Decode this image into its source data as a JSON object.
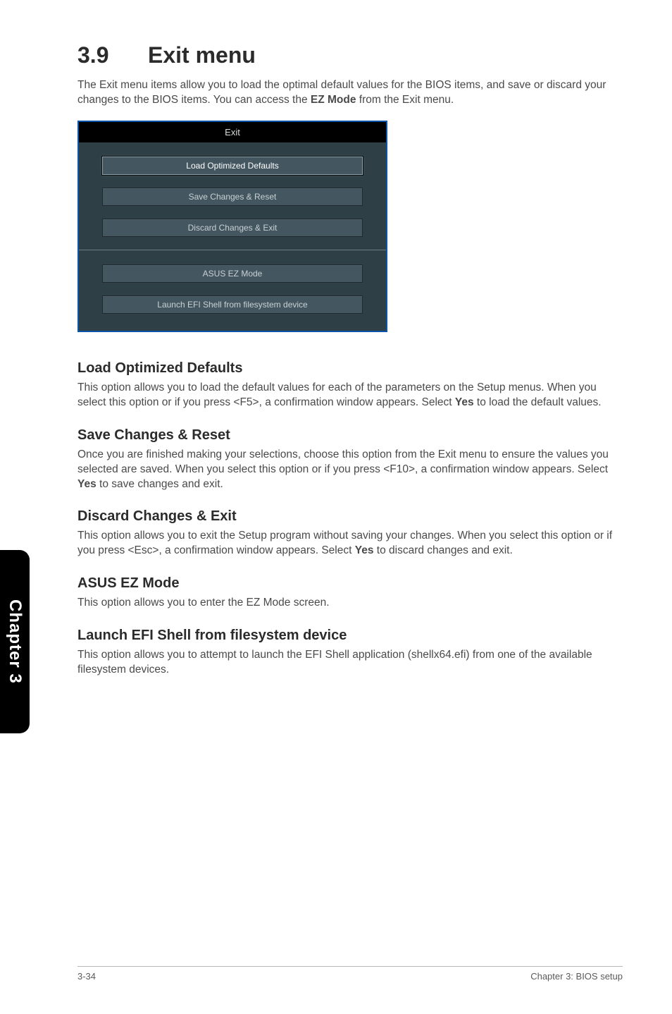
{
  "heading": {
    "number": "3.9",
    "title": "Exit menu"
  },
  "intro": {
    "before": "The Exit menu items allow you to load the optimal default values for the BIOS items, and save or discard your changes to the BIOS items. You can access the ",
    "bold": "EZ Mode",
    "after": " from the Exit menu."
  },
  "bios": {
    "title": "Exit",
    "items": [
      {
        "label": "Load Optimized Defaults",
        "selected": true
      },
      {
        "label": "Save Changes & Reset",
        "selected": false
      },
      {
        "label": "Discard Changes & Exit",
        "selected": false
      }
    ],
    "lower_items": [
      {
        "label": "ASUS EZ Mode"
      },
      {
        "label": "Launch EFI Shell from filesystem device"
      }
    ]
  },
  "sections": [
    {
      "title": "Load Optimized Defaults",
      "parts": [
        {
          "t": "text",
          "v": "This option allows you to load the default values for each of the parameters on the Setup menus. When you select this option or if you press <F5>, a confirmation window appears. Select "
        },
        {
          "t": "bold",
          "v": "Yes"
        },
        {
          "t": "text",
          "v": " to load the default values."
        }
      ]
    },
    {
      "title": "Save Changes & Reset",
      "parts": [
        {
          "t": "text",
          "v": "Once you are finished making your selections, choose this option from the Exit menu to ensure the values you selected are saved. When you select this option or if you press <F10>, a confirmation window appears. Select "
        },
        {
          "t": "bold",
          "v": "Yes"
        },
        {
          "t": "text",
          "v": " to save changes and exit."
        }
      ]
    },
    {
      "title": "Discard Changes & Exit",
      "parts": [
        {
          "t": "text",
          "v": "This option allows you to exit the Setup program without saving your changes. When you select this option or if you press <Esc>, a confirmation window appears. Select "
        },
        {
          "t": "bold",
          "v": "Yes"
        },
        {
          "t": "text",
          "v": " to discard changes and exit."
        }
      ]
    },
    {
      "title": "ASUS EZ Mode",
      "parts": [
        {
          "t": "text",
          "v": "This option allows you to enter the EZ Mode screen."
        }
      ]
    },
    {
      "title": "Launch EFI Shell from filesystem device",
      "parts": [
        {
          "t": "text",
          "v": "This option allows you to attempt to launch the EFI Shell application (shellx64.efi) from one of the available filesystem devices."
        }
      ]
    }
  ],
  "side_tab": "Chapter 3",
  "footer": {
    "left": "3-34",
    "right": "Chapter 3: BIOS setup"
  }
}
